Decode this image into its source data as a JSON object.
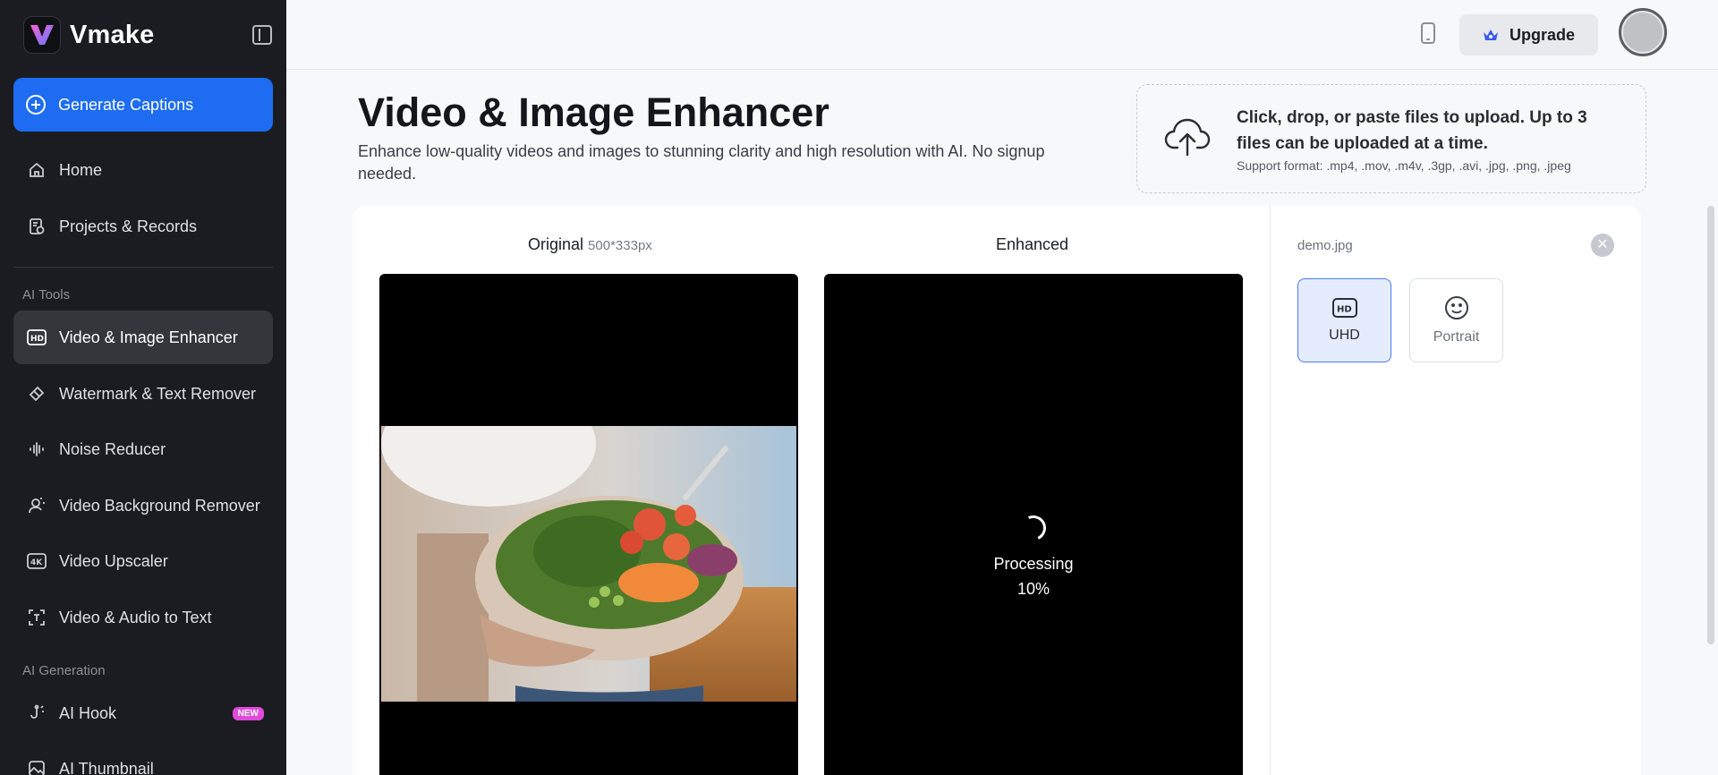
{
  "app": {
    "name": "Vmake"
  },
  "sidebar": {
    "generate_label": "Generate Captions",
    "section_tools": "AI Tools",
    "section_generation": "AI Generation",
    "items": [
      {
        "label": "Home",
        "icon": "home-icon"
      },
      {
        "label": "Projects & Records",
        "icon": "projects-icon"
      },
      {
        "label": "Video & Image Enhancer",
        "icon": "hd-icon",
        "active": true
      },
      {
        "label": "Watermark & Text Remover",
        "icon": "eraser-icon"
      },
      {
        "label": "Noise Reducer",
        "icon": "waveform-icon"
      },
      {
        "label": "Video Background Remover",
        "icon": "person-cutout-icon"
      },
      {
        "label": "Video Upscaler",
        "icon": "4k-icon"
      },
      {
        "label": "Video & Audio to Text",
        "icon": "text-frame-icon"
      },
      {
        "label": "AI Hook",
        "icon": "hook-icon",
        "badge": "NEW"
      },
      {
        "label": "AI Thumbnail",
        "icon": "image-icon"
      }
    ]
  },
  "topbar": {
    "upgrade_label": "Upgrade"
  },
  "header": {
    "title": "Video & Image Enhancer",
    "subtitle": "Enhance low-quality videos and images to stunning clarity and high resolution with AI. No signup needed."
  },
  "upload": {
    "title": "Click, drop, or paste files to upload. Up to 3 files can be uploaded at a time.",
    "formats": "Support format: .mp4, .mov, .m4v, .3gp, .avi, .jpg, .png, .jpeg"
  },
  "preview": {
    "original_label": "Original",
    "original_dims": "500*333px",
    "enhanced_label": "Enhanced",
    "processing_label": "Processing",
    "progress": "10%"
  },
  "side_panel": {
    "file_name": "demo.jpg",
    "modes": [
      {
        "label": "UHD",
        "icon": "hd-badge-icon",
        "selected": true
      },
      {
        "label": "Portrait",
        "icon": "smiley-icon",
        "selected": false
      }
    ]
  },
  "colors": {
    "accent": "#1d6cf2",
    "sidebar_bg": "#1a1c21",
    "badge": "#e04ad9"
  }
}
